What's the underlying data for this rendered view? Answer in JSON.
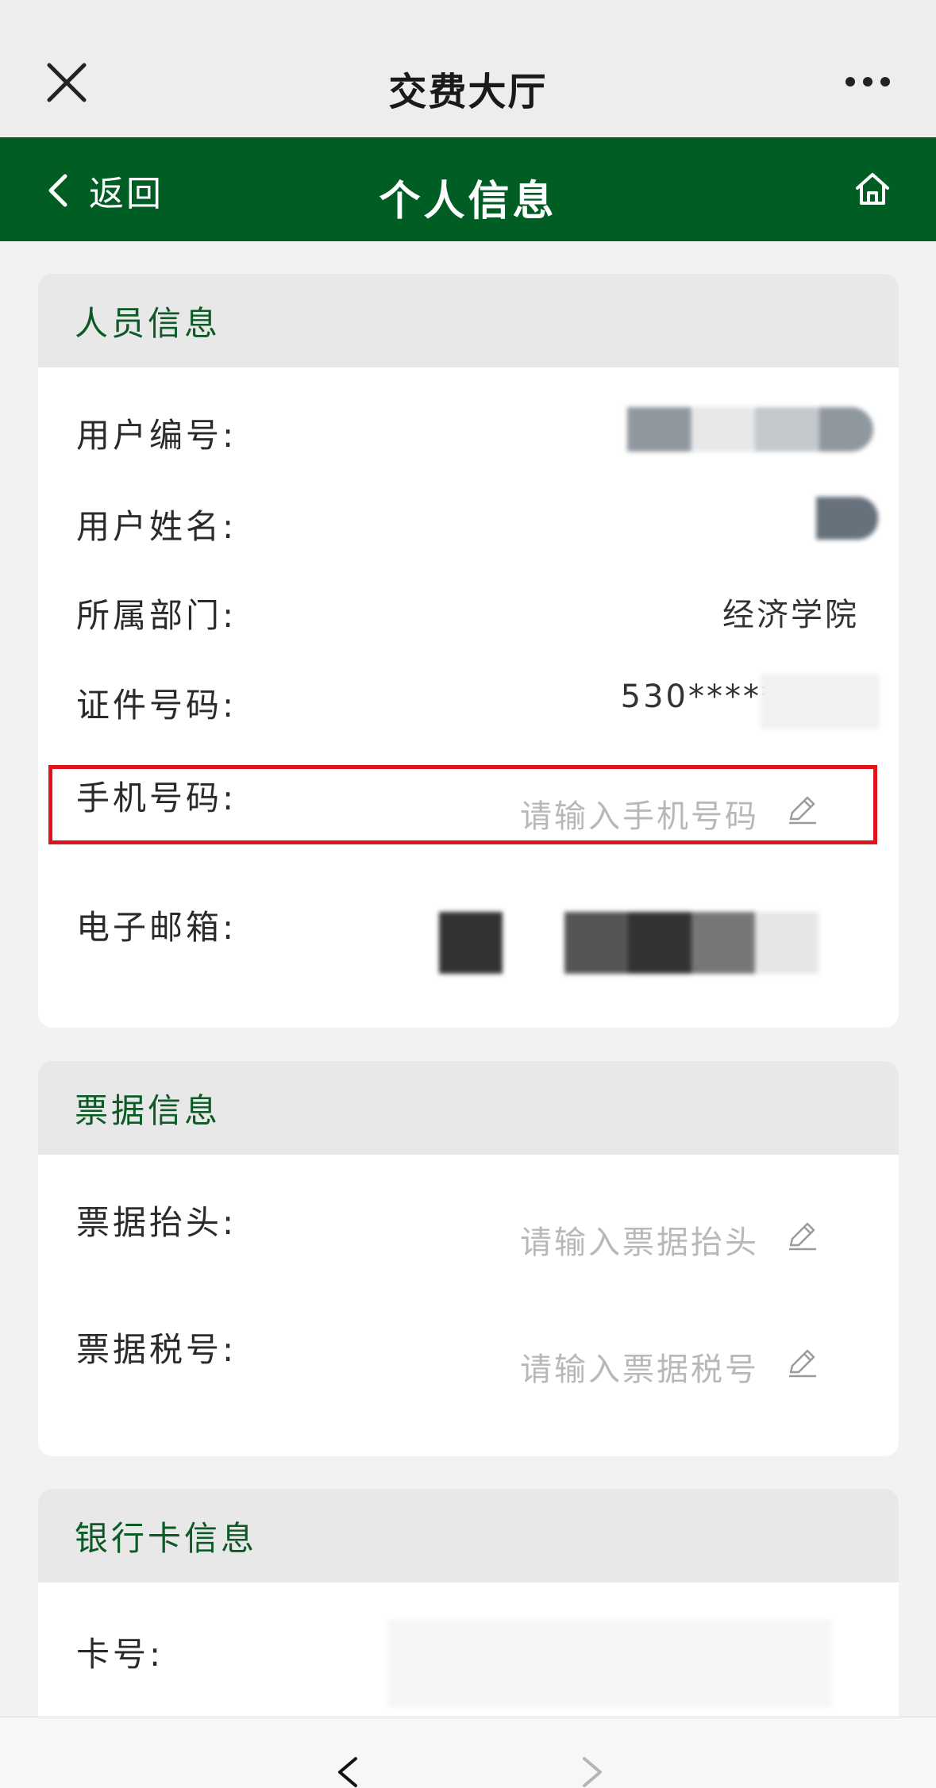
{
  "wechat_bar": {
    "title": "交费大厅"
  },
  "header": {
    "back_label": "返回",
    "title": "个人信息"
  },
  "personal_section": {
    "title": "人员信息",
    "fields": {
      "user_id_label": "用户编号:",
      "user_name_label": "用户姓名:",
      "department_label": "所属部门:",
      "department_value": "经济学院",
      "id_number_label": "证件号码:",
      "id_number_value": "530*****",
      "phone_label": "手机号码:",
      "phone_placeholder": "请输入手机号码",
      "email_label": "电子邮箱:"
    }
  },
  "invoice_section": {
    "title": "票据信息",
    "fields": {
      "invoice_title_label": "票据抬头:",
      "invoice_title_placeholder": "请输入票据抬头",
      "tax_number_label": "票据税号:",
      "tax_number_placeholder": "请输入票据税号"
    }
  },
  "bank_section": {
    "title": "银行卡信息",
    "fields": {
      "card_number_label": "卡号:"
    }
  },
  "colors": {
    "header_green": "#005e25",
    "section_title_green": "#0c5a26",
    "highlight_red": "#e0141b",
    "placeholder_gray": "#b8b8b8"
  },
  "icons": [
    "close-icon",
    "more-icon",
    "back-chevron-icon",
    "home-icon",
    "edit-pencil-icon",
    "prev-arrow-icon",
    "next-arrow-icon"
  ]
}
